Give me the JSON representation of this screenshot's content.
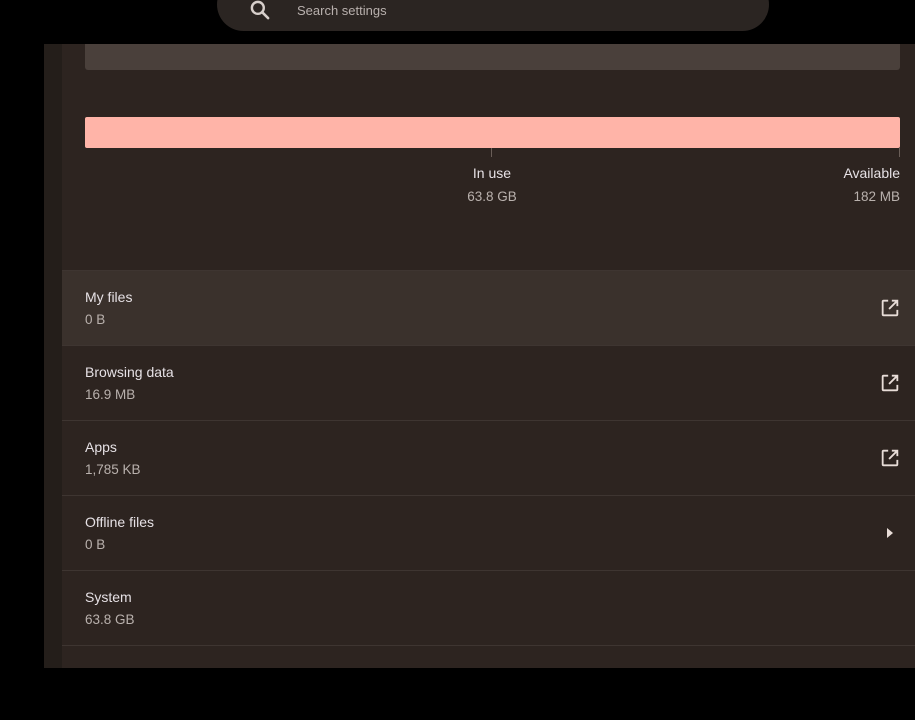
{
  "search": {
    "placeholder": "Search settings"
  },
  "storage": {
    "in_use_label": "In use",
    "in_use_value": "63.8 GB",
    "available_label": "Available",
    "available_value": "182 MB"
  },
  "items": [
    {
      "title": "My files",
      "value": "0 B",
      "icon": "open-in-new-icon"
    },
    {
      "title": "Browsing data",
      "value": "16.9 MB",
      "icon": "open-in-new-icon"
    },
    {
      "title": "Apps",
      "value": "1,785 KB",
      "icon": "open-in-new-icon"
    },
    {
      "title": "Offline files",
      "value": "0 B",
      "icon": "arrow-right-icon"
    },
    {
      "title": "System",
      "value": "63.8 GB"
    }
  ],
  "colors": {
    "usage_bar": "#ffb4a8",
    "panel": "#2d2420",
    "accent_icon": "#e8ddd8"
  }
}
